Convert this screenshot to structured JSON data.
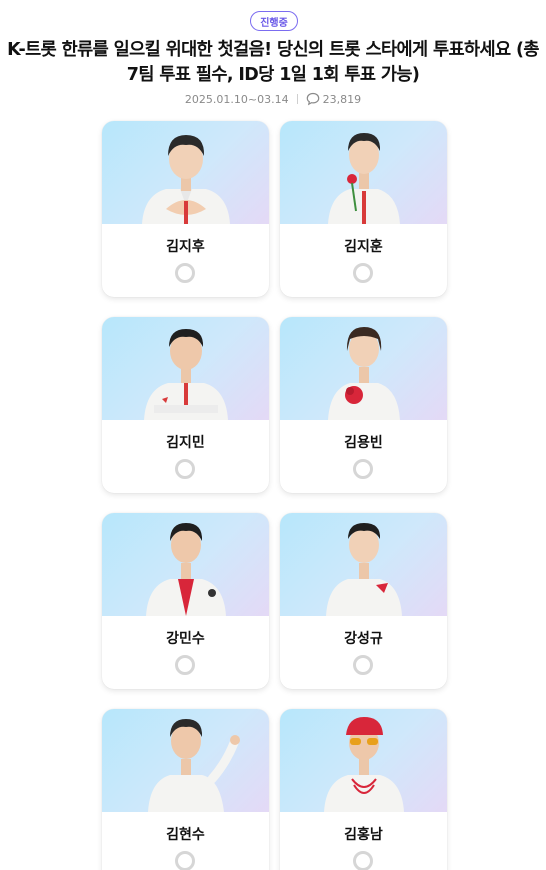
{
  "header": {
    "status_badge": "진행중",
    "title": "K-트롯 한류를 일으킬 위대한 첫걸음! 당신의 트롯 스타에게 투표하세요 (총 7팀 투표 필수, ID당 1일 1회 투표 가능)",
    "period": "2025.01.10~03.14",
    "comment_count": "23,819",
    "comment_icon": "speech-bubble-icon"
  },
  "candidates": [
    {
      "name": "김지후",
      "selected": false
    },
    {
      "name": "김지훈",
      "selected": false
    },
    {
      "name": "김지민",
      "selected": false
    },
    {
      "name": "김용빈",
      "selected": false
    },
    {
      "name": "강민수",
      "selected": false
    },
    {
      "name": "강성규",
      "selected": false
    },
    {
      "name": "김현수",
      "selected": false
    },
    {
      "name": "김홍남",
      "selected": false
    }
  ],
  "colors": {
    "accent": "#6a59e8",
    "photo_bg_start": "#b7e7fb",
    "photo_bg_end": "#e4d9f6",
    "radio_border": "#d6d6d6"
  }
}
